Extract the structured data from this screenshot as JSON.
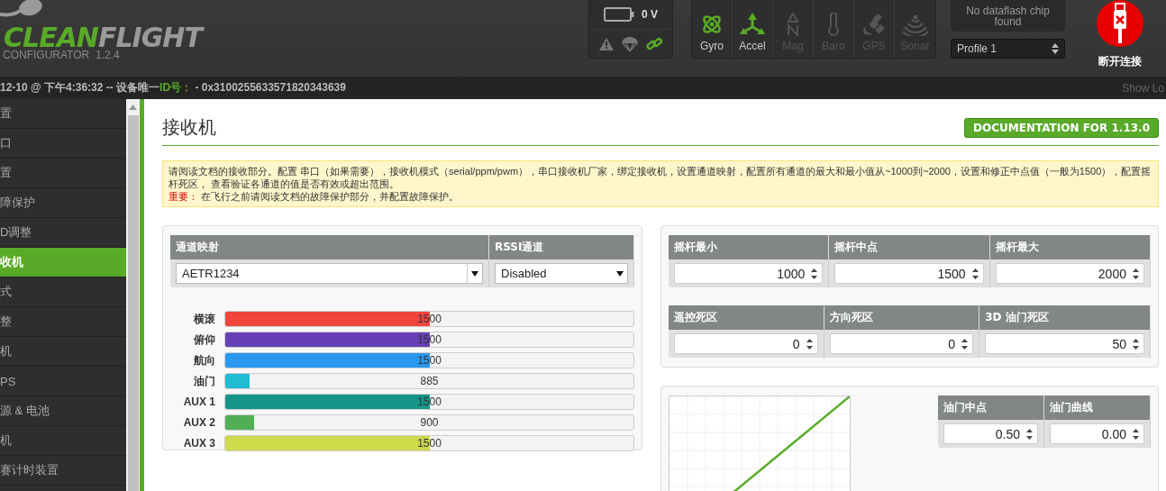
{
  "header": {
    "logo": {
      "green_part": "CLEAN",
      "grey_part": "FLIGHT"
    },
    "subtitle": "CONFIGURATOR  1.2.4",
    "battery": {
      "voltage": "0 V"
    },
    "status_icons": [
      {
        "kind": "warning",
        "on": false
      },
      {
        "kind": "parachute",
        "on": false
      },
      {
        "kind": "link",
        "on": true
      }
    ],
    "sensors": [
      {
        "kind": "gyro",
        "label": "Gyro",
        "on": true
      },
      {
        "kind": "accel",
        "label": "Accel",
        "on": true
      },
      {
        "kind": "mag",
        "label": "Mag",
        "on": false
      },
      {
        "kind": "baro",
        "label": "Baro",
        "on": false
      },
      {
        "kind": "gps",
        "label": "GPS",
        "on": false
      },
      {
        "kind": "sonar",
        "label": "Sonar",
        "on": false
      }
    ],
    "dataflash": "No dataflash chip found",
    "profile": "Profile 1",
    "disconnect": "断开连接"
  },
  "status_bar": {
    "date": "12-10 @ 下午4:36:32 -- 设备唯一",
    "id_label": "ID号：",
    "id_value": "- 0x3100255633571820343639",
    "show_log": "Show Lo"
  },
  "sidebar": {
    "items": [
      {
        "label": "置",
        "selected": false
      },
      {
        "label": "口",
        "selected": false
      },
      {
        "label": "置",
        "selected": false
      },
      {
        "label": "障保护",
        "selected": false
      },
      {
        "label": "D调整",
        "selected": false
      },
      {
        "label": "收机",
        "selected": true
      },
      {
        "label": "式",
        "selected": false
      },
      {
        "label": "整",
        "selected": false
      },
      {
        "label": "机",
        "selected": false
      },
      {
        "label": "PS",
        "selected": false
      },
      {
        "label": "源 & 电池",
        "selected": false
      },
      {
        "label": "机",
        "selected": false
      },
      {
        "label": "赛计时装置",
        "selected": false
      }
    ]
  },
  "page": {
    "title": "接收机",
    "doc_button": "DOCUMENTATION FOR 1.13.0",
    "note": "请阅读文档的接收部分。配置 串口（如果需要），接收机模式（serial/ppm/pwm），串口接收机厂家，绑定接收机，设置通道映射，配置所有通道的最大和最小值从~1000到~2000，设置和修正中点值（一般为1500），配置摇杆死区， 查看验证各通道的值是否有效或超出范围。",
    "important_label": "重要：",
    "important_text": "在飞行之前请阅读文档的故障保护部分，并配置故障保护。"
  },
  "channel_map": {
    "map_header": "通道映射",
    "rssi_header": "RSSI通道",
    "map_value": "AETR1234",
    "rssi_value": "Disabled"
  },
  "channels": [
    {
      "name": "横滚",
      "value": "1500",
      "level": 0.5,
      "color": "#f1453d"
    },
    {
      "name": "俯仰",
      "value": "1500",
      "level": 0.5,
      "color": "#673fb4"
    },
    {
      "name": "航向",
      "value": "1500",
      "level": 0.5,
      "color": "#2b98f0"
    },
    {
      "name": "油门",
      "value": "885",
      "level": 0.06,
      "color": "#1fbcd2"
    },
    {
      "name": "AUX 1",
      "value": "1500",
      "level": 0.5,
      "color": "#159588"
    },
    {
      "name": "AUX 2",
      "value": "900",
      "level": 0.07,
      "color": "#50ae55"
    },
    {
      "name": "AUX 3",
      "value": "1500",
      "level": 0.5,
      "color": "#cdda49"
    }
  ],
  "stick_fields": [
    {
      "label": "摇杆最小",
      "value": "1000"
    },
    {
      "label": "摇杆中点",
      "value": "1500"
    },
    {
      "label": "摇杆最大",
      "value": "2000"
    }
  ],
  "deadband_fields": [
    {
      "label": "遥控死区",
      "value": "0"
    },
    {
      "label": "方向死区",
      "value": "0"
    },
    {
      "label": "3D 油门死区",
      "value": "50"
    }
  ],
  "throttle_fields": [
    {
      "label": "油门中点",
      "value": "0.50"
    },
    {
      "label": "油门曲线",
      "value": "0.00"
    }
  ]
}
